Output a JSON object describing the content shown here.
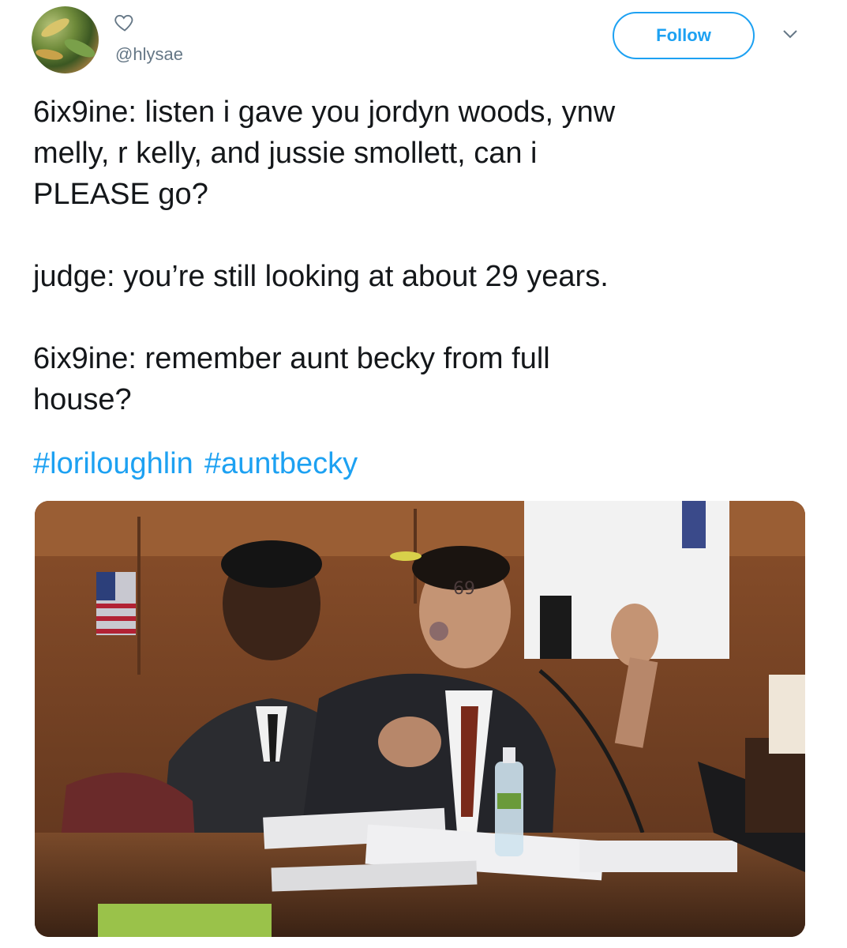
{
  "tweet": {
    "handle": "@hlysae",
    "follow_label": "Follow",
    "text": "6ix9ine: listen i gave you jordyn woods, ynw\nmelly, r kelly, and jussie smollett, can i\nPLEASE go?\n\njudge: you’re still looking at about 29 years.\n\n6ix9ine: remember aunt becky from full\nhouse?",
    "hashtags": [
      "#loriloughlin",
      "#auntbecky"
    ]
  },
  "icons": {
    "like": "heart-icon",
    "menu": "chevron-down-icon",
    "avatar": "avatar"
  },
  "colors": {
    "accent": "#1da1f2",
    "text": "#14171a",
    "muted": "#657786"
  }
}
